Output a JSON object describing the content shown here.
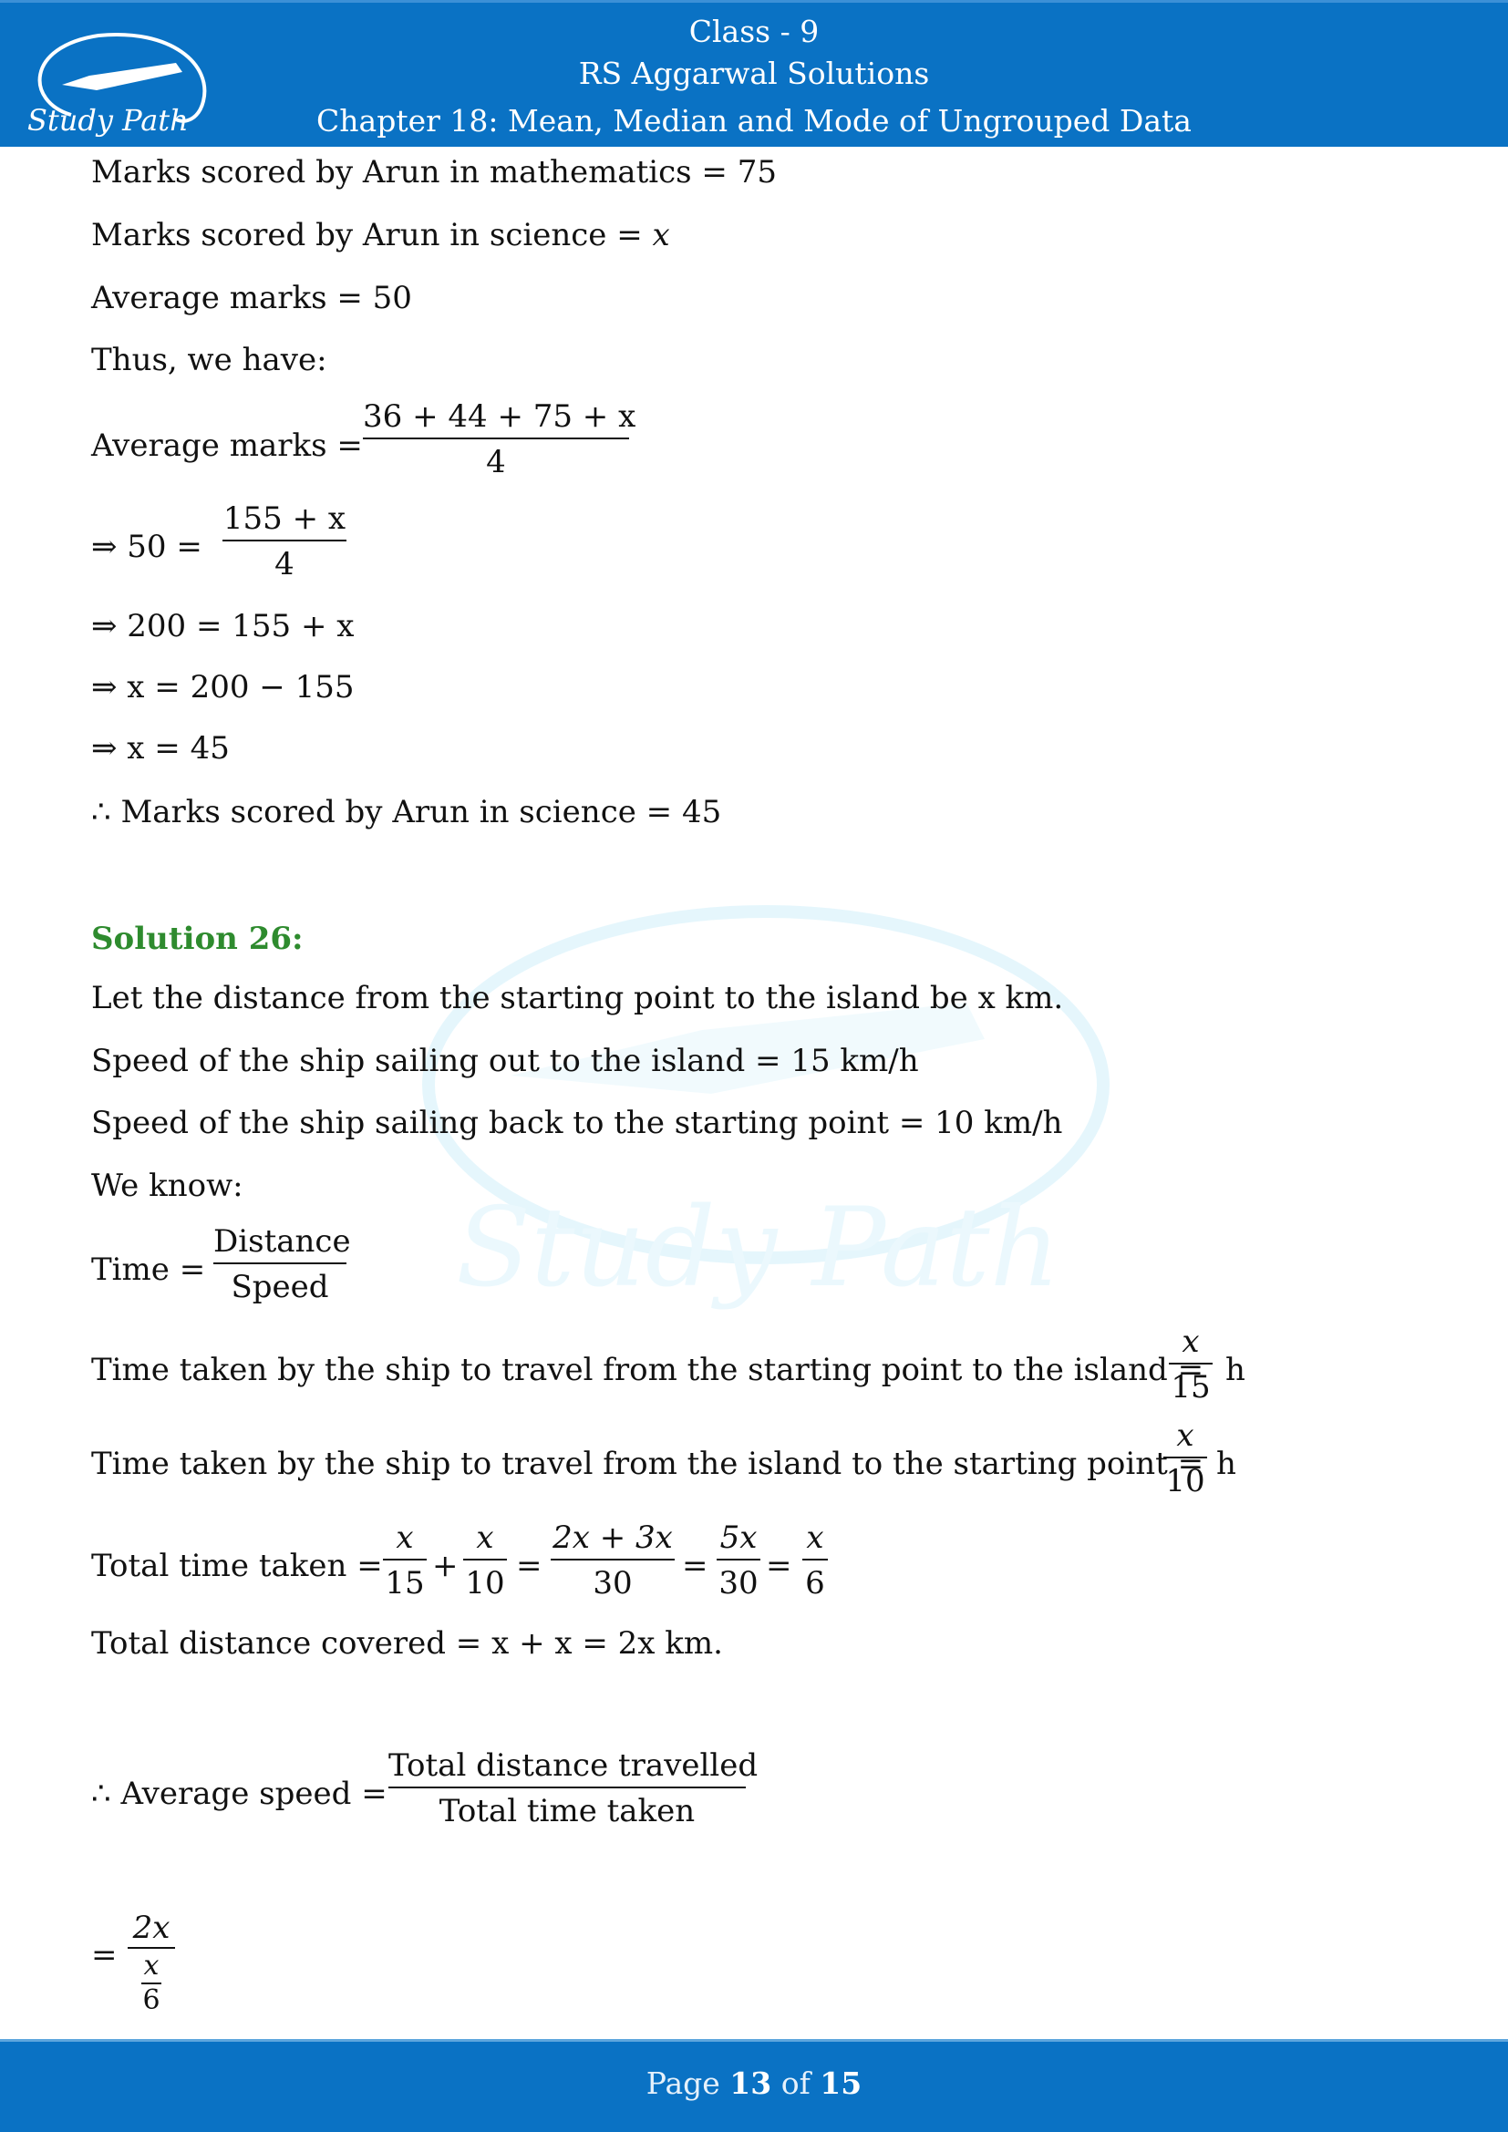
{
  "header": {
    "logo_text": "Study Path",
    "line1": "Class - 9",
    "line2": "RS Aggarwal Solutions",
    "line3": "Chapter 18: Mean, Median and Mode of Ungrouped Data"
  },
  "content": {
    "l1": "Marks scored by Arun in mathematics = 75",
    "l2a": "Marks scored by Arun in science = ",
    "l2x": "x",
    "l3": "Average marks = 50",
    "l4": "Thus, we have:",
    "eq1_lhs": "Average marks =",
    "eq1_num": "36 + 44 + 75 + x",
    "eq1_den": "4",
    "eq2_lhs": "⇒  50 =",
    "eq2_num": "155 + x",
    "eq2_den": "4",
    "eq3": "⇒ 200 = 155 + x",
    "eq4": "⇒ x = 200 − 155",
    "eq5": "⇒ x = 45",
    "conclusion1": "∴ Marks scored by Arun in science = 45",
    "solution_heading": "Solution 26:",
    "s1": "Let the distance from the starting point to the island be x km.",
    "s2": "Speed of the ship sailing out to the island = 15 km/h",
    "s3": "Speed of the ship sailing back to the starting point = 10 km/h",
    "s4": "We know:",
    "time_lhs": "Time =",
    "time_num": "Distance",
    "time_den": "Speed",
    "t1_text": "Time taken by the ship to travel from the starting point to the island  =",
    "t1_num": "x",
    "t1_den": "15",
    "t1_unit": "h",
    "t2_text": "Time taken by the ship to travel from the island to the starting point =",
    "t2_num": "x",
    "t2_den": "10",
    "t2_unit": "h",
    "total_lhs": "Total time taken =",
    "tt_f1_num": "x",
    "tt_f1_den": "15",
    "tt_plus": "+",
    "tt_f2_num": "x",
    "tt_f2_den": "10",
    "tt_eq1": "=",
    "tt_f3_num": "2x + 3x",
    "tt_f3_den": "30",
    "tt_eq2": "=",
    "tt_f4_num": "5x",
    "tt_f4_den": "30",
    "tt_eq3": "=",
    "tt_f5_num": "x",
    "tt_f5_den": "6",
    "dist": "Total distance covered = x + x = 2x km.",
    "avg_lhs": "∴ Average speed =",
    "avg_num": "Total distance travelled",
    "avg_den": "Total time taken",
    "last_eq": "=",
    "last_num": "2x",
    "last_den_num": "x",
    "last_den_den": "6"
  },
  "footer": {
    "page_prefix": "Page ",
    "page_current": "13",
    "page_of": " of ",
    "page_total": "15"
  },
  "colors": {
    "header_bg": "#0a72c4",
    "solution_heading": "#2e8b2e",
    "watermark": "#cdeffb"
  }
}
